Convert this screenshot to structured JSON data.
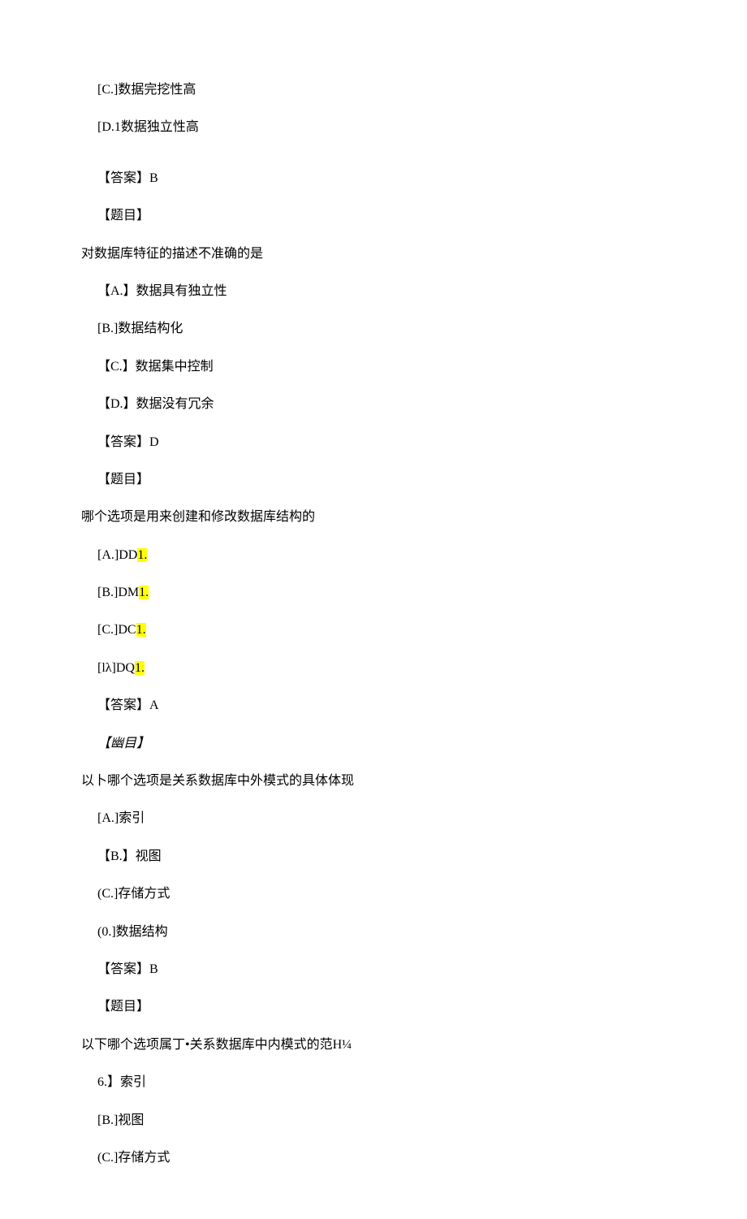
{
  "lines": [
    {
      "cls": "indent1",
      "text": "[C.]数据完挖性高"
    },
    {
      "cls": "indent1 gap",
      "text": "[D.1数据独立性高"
    },
    {
      "cls": "indent1",
      "text": "【答案】B"
    },
    {
      "cls": "indent1",
      "text": "【题目】"
    },
    {
      "cls": "indent0",
      "text": "对数据库特征的描述不准确的是"
    },
    {
      "cls": "indent1",
      "text": "【A.】数据具有独立性"
    },
    {
      "cls": "indent1",
      "text": "[B.]数据结构化"
    },
    {
      "cls": "indent1",
      "text": "【C.】数据集中控制"
    },
    {
      "cls": "indent1",
      "text": "【D.】数据没有冗余"
    },
    {
      "cls": "indent1",
      "text": "【答案】D"
    },
    {
      "cls": "indent1",
      "text": "【题目】"
    },
    {
      "cls": "indent0",
      "text": "哪个选项是用来创建和修改数据库结构的"
    },
    {
      "cls": "indent1",
      "pre": "[A.]DD",
      "hl": "1."
    },
    {
      "cls": "indent1",
      "pre": "[B.]DM",
      "hl": "1."
    },
    {
      "cls": "indent1",
      "pre": "[C.]DC",
      "hl": "1."
    },
    {
      "cls": "indent1",
      "pre": "[lλ]DQ",
      "hl": "1."
    },
    {
      "cls": "indent1",
      "text": "【答案】A"
    },
    {
      "cls": "indent1 italic",
      "text": "【幽目】"
    },
    {
      "cls": "indent0",
      "text": "以卜哪个选项是关系数据库中外模式的具体体现"
    },
    {
      "cls": "indent1",
      "text": "[A.]索引"
    },
    {
      "cls": "indent1",
      "text": "【B.】视图"
    },
    {
      "cls": "indent1",
      "text": "(C.]存储方式"
    },
    {
      "cls": "indent1",
      "text": "(0.]数据结构"
    },
    {
      "cls": "indent1",
      "text": "【答案】B"
    },
    {
      "cls": "indent1",
      "text": "【题目】"
    },
    {
      "cls": "indent0",
      "text": "以下哪个选项属丁•关系数据库中内模式的范H¼"
    },
    {
      "cls": "indent1",
      "text": "6.】索引"
    },
    {
      "cls": "indent1",
      "text": "[B.]视图"
    },
    {
      "cls": "indent1",
      "text": "(C.]存储方式"
    }
  ]
}
